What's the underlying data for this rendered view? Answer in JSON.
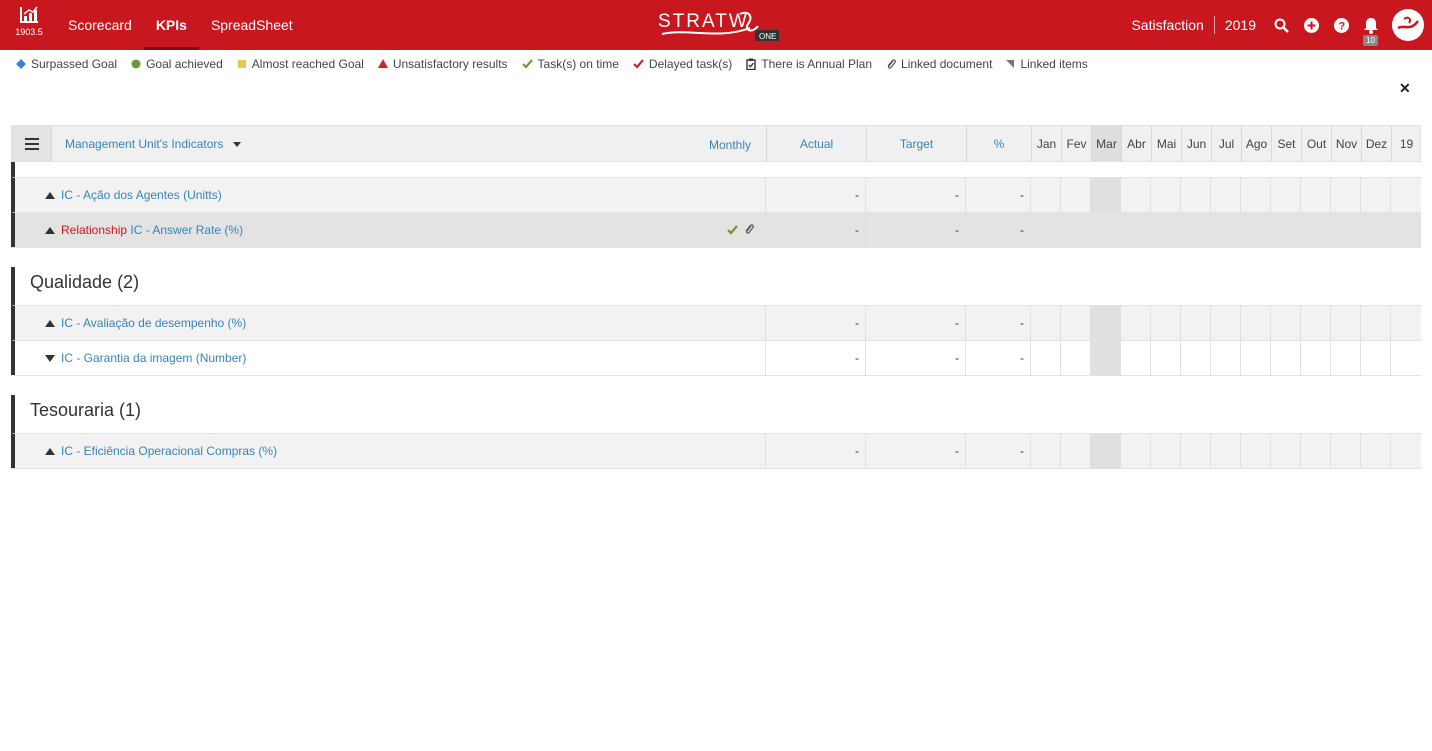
{
  "topbar": {
    "version": "1903.5",
    "nav": [
      "Scorecard",
      "KPIs",
      "SpreadSheet"
    ],
    "active_nav": "KPIs",
    "logo_text": "STRATWs",
    "logo_sub": "ONE",
    "context": "Satisfaction",
    "year": "2019",
    "notifications": "10",
    "brand_color": "#c8171e"
  },
  "legend": [
    {
      "label": "Surpassed Goal",
      "icon": "blue-diamond-icon",
      "color": "#3784d6"
    },
    {
      "label": "Goal achieved",
      "icon": "green-circle-icon",
      "color": "#6a9a3a"
    },
    {
      "label": "Almost reached Goal",
      "icon": "yellow-square-icon",
      "color": "#e8c84a"
    },
    {
      "label": "Unsatisfactory results",
      "icon": "red-triangle-icon",
      "color": "#d32027"
    },
    {
      "label": "Task(s) on time",
      "icon": "green-check-icon",
      "color": "#6a9a3a"
    },
    {
      "label": "Delayed task(s)",
      "icon": "red-check-icon",
      "color": "#d32027"
    },
    {
      "label": "There is Annual Plan",
      "icon": "clipboard-icon",
      "color": "#333333"
    },
    {
      "label": "Linked document",
      "icon": "paperclip-icon",
      "color": "#555555"
    },
    {
      "label": "Linked items",
      "icon": "corner-flag-icon",
      "color": "#777777"
    }
  ],
  "table": {
    "title": "Management Unit's Indicators",
    "period": "Monthly",
    "columns": {
      "actual": "Actual",
      "target": "Target",
      "pct": "%"
    },
    "months": [
      "Jan",
      "Fev",
      "Mar",
      "Abr",
      "Mai",
      "Jun",
      "Jul",
      "Ago",
      "Set",
      "Out",
      "Nov",
      "Dez",
      "19"
    ],
    "highlight_month": "Mar"
  },
  "groups": [
    {
      "title": "",
      "rows": [
        {
          "prefix": "",
          "name": "IC - Ação dos Agentes (Unitts)",
          "trend": "up",
          "actual": "-",
          "target": "-",
          "pct": "-",
          "icons": []
        },
        {
          "prefix": "Relationship",
          "name": "IC - Answer Rate (%)",
          "trend": "up",
          "actual": "-",
          "target": "-",
          "pct": "-",
          "icons": [
            "green-check-icon",
            "paperclip-icon"
          ]
        }
      ]
    },
    {
      "title": "Qualidade (2)",
      "rows": [
        {
          "prefix": "",
          "name": "IC - Avaliação de desempenho (%)",
          "trend": "up",
          "actual": "-",
          "target": "-",
          "pct": "-",
          "icons": []
        },
        {
          "prefix": "",
          "name": "IC - Garantia da imagem (Number)",
          "trend": "down",
          "actual": "-",
          "target": "-",
          "pct": "-",
          "icons": []
        }
      ]
    },
    {
      "title": "Tesouraria (1)",
      "rows": [
        {
          "prefix": "",
          "name": "IC - Eficiência Operacional Compras (%)",
          "trend": "up",
          "actual": "-",
          "target": "-",
          "pct": "-",
          "icons": []
        }
      ]
    }
  ]
}
